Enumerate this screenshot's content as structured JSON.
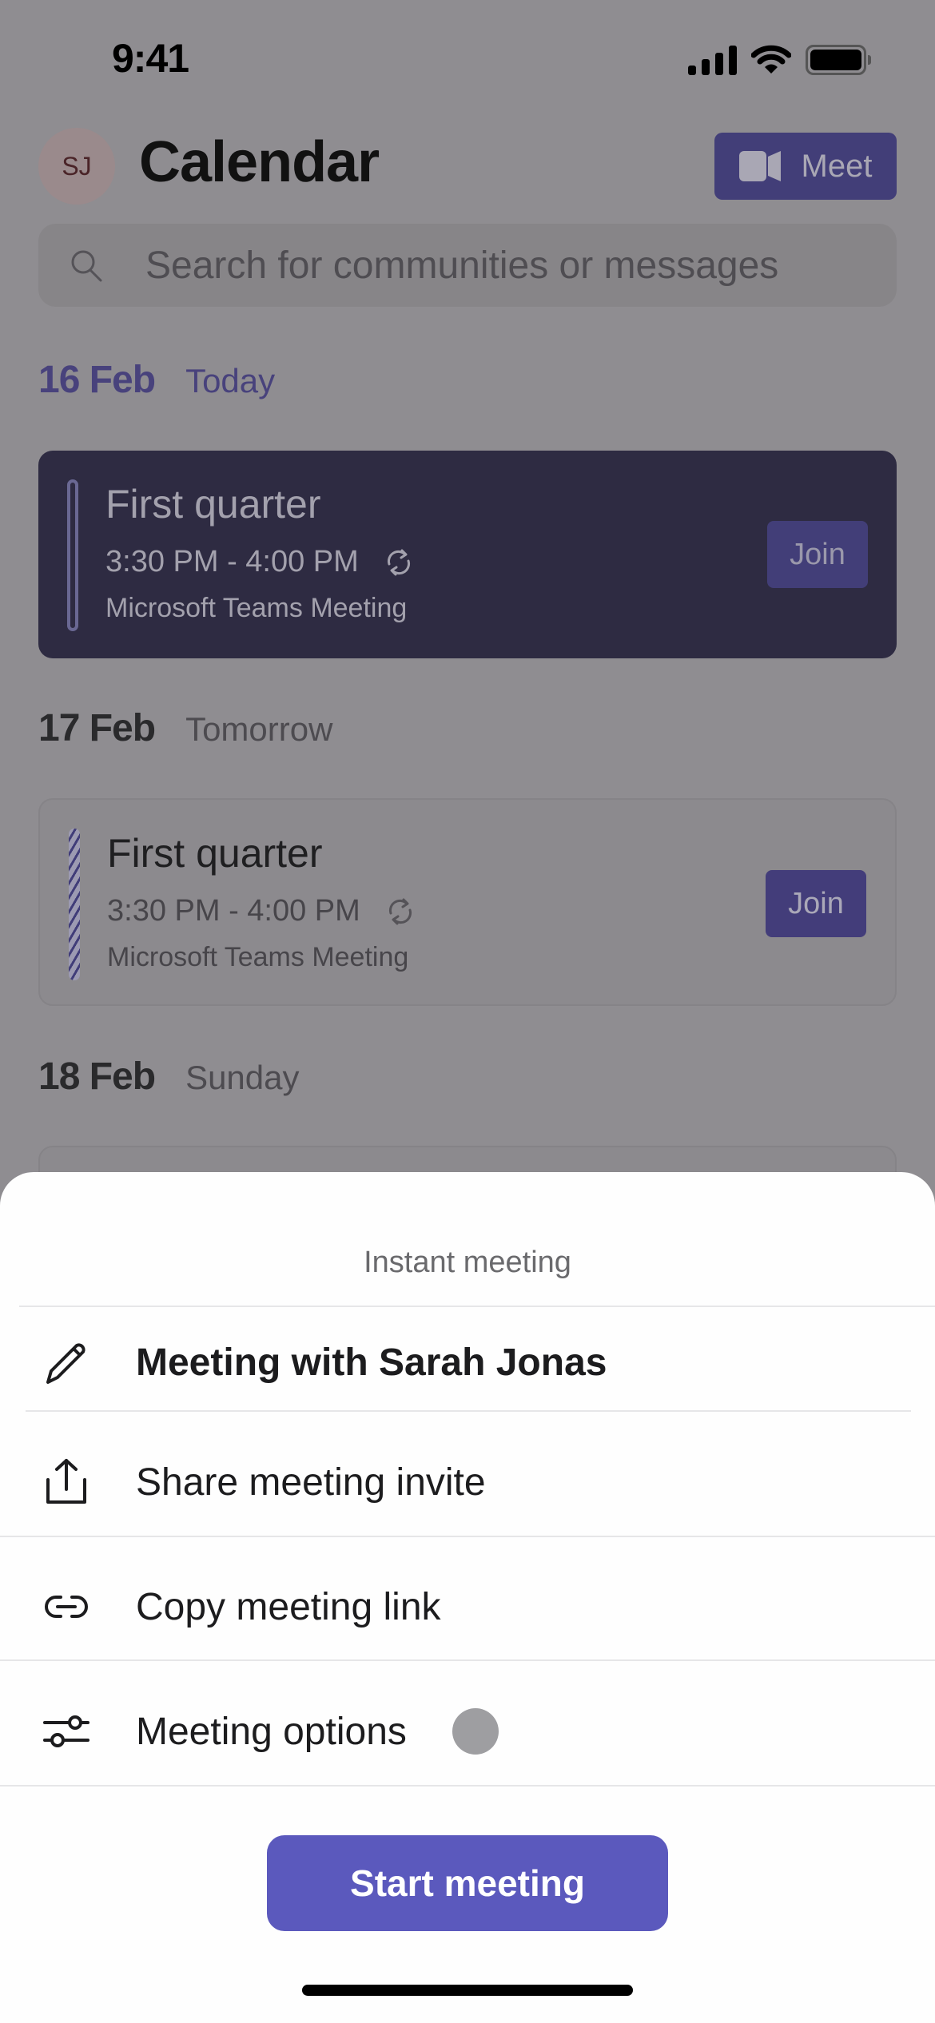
{
  "status_bar": {
    "time": "9:41"
  },
  "header": {
    "avatar_initials": "SJ",
    "title": "Calendar",
    "meet_label": "Meet"
  },
  "search": {
    "placeholder": "Search for communities or messages",
    "value": ""
  },
  "days": [
    {
      "date": "16 Feb",
      "label": "Today",
      "event": {
        "title": "First quarter",
        "time": "3:30 PM - 4:00 PM",
        "recurring": true,
        "location": "Microsoft Teams Meeting",
        "join_label": "Join",
        "state": "active"
      }
    },
    {
      "date": "17 Feb",
      "label": "Tomorrow",
      "event": {
        "title": "First quarter",
        "time": "3:30 PM - 4:00 PM",
        "recurring": true,
        "location": "Microsoft Teams Meeting",
        "join_label": "Join",
        "state": "upcoming"
      }
    },
    {
      "date": "18 Feb",
      "label": "Sunday"
    }
  ],
  "sheet": {
    "title": "Instant meeting",
    "items": [
      {
        "icon": "pencil-icon",
        "label": "Meeting with Sarah Jonas"
      },
      {
        "icon": "share-icon",
        "label": "Share meeting invite"
      },
      {
        "icon": "link-icon",
        "label": "Copy meeting link"
      },
      {
        "icon": "sliders-icon",
        "label": "Meeting options"
      }
    ],
    "start_label": "Start meeting"
  },
  "colors": {
    "accent": "#5b59bd",
    "overlay": "#8f8d91",
    "active_card": "#2e2b42"
  }
}
